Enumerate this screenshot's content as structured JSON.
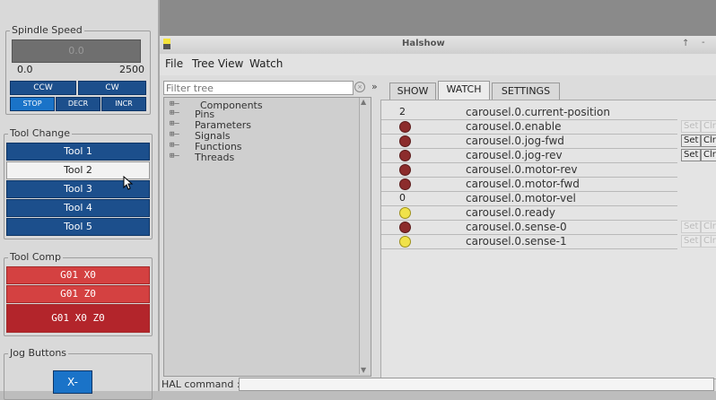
{
  "left": {
    "spindle": {
      "legend": "Spindle Speed",
      "display_value": "0.0",
      "min_label": "0.0",
      "max_label": "2500",
      "buttons": [
        "CCW",
        "CW"
      ],
      "small_buttons": [
        "STOP",
        "DECR",
        "INCR"
      ]
    },
    "tool_change": {
      "legend": "Tool Change",
      "tools": [
        "Tool 1",
        "Tool 2",
        "Tool 3",
        "Tool 4",
        "Tool 5"
      ],
      "selected": "Tool 2"
    },
    "tool_comp": {
      "legend": "Tool Comp",
      "buttons": [
        "G01 X0",
        "G01 Z0",
        "G01 X0 Z0"
      ]
    },
    "jog": {
      "legend": "Jog Buttons",
      "button": "X-"
    }
  },
  "window": {
    "title": "Halshow",
    "title_controls": [
      "↑",
      "-"
    ],
    "menu": [
      "File",
      "Tree View",
      "Watch"
    ],
    "filter_placeholder": "Filter tree",
    "filter_arrow": "»",
    "tree": [
      "Components",
      "Pins",
      "Parameters",
      "Signals",
      "Functions",
      "Threads"
    ],
    "tabs": [
      "SHOW",
      "WATCH",
      "SETTINGS"
    ],
    "active_tab": "WATCH",
    "watch": [
      {
        "value": "2",
        "name": "carousel.0.current-position",
        "buttons": "none"
      },
      {
        "led": "red",
        "name": "carousel.0.enable",
        "buttons": "disabled"
      },
      {
        "led": "red",
        "name": "carousel.0.jog-fwd",
        "buttons": "enabled"
      },
      {
        "led": "red",
        "name": "carousel.0.jog-rev",
        "buttons": "enabled"
      },
      {
        "led": "red",
        "name": "carousel.0.motor-rev",
        "buttons": "none"
      },
      {
        "led": "red",
        "name": "carousel.0.motor-fwd",
        "buttons": "none"
      },
      {
        "value": "0",
        "name": "carousel.0.motor-vel",
        "buttons": "none"
      },
      {
        "led": "yellow",
        "name": "carousel.0.ready",
        "buttons": "none"
      },
      {
        "led": "red",
        "name": "carousel.0.sense-0",
        "buttons": "disabled"
      },
      {
        "led": "yellow",
        "name": "carousel.0.sense-1",
        "buttons": "disabled"
      }
    ],
    "set_label": "Set",
    "clr_label": "Clr",
    "hal_command_label": "HAL command :"
  },
  "colors": {
    "blue_button": "#1c4f8c",
    "red_button": "#d44141",
    "dark_red_button": "#b3252b",
    "led_red": "#8c2c2c",
    "led_yellow": "#f0e24a"
  }
}
